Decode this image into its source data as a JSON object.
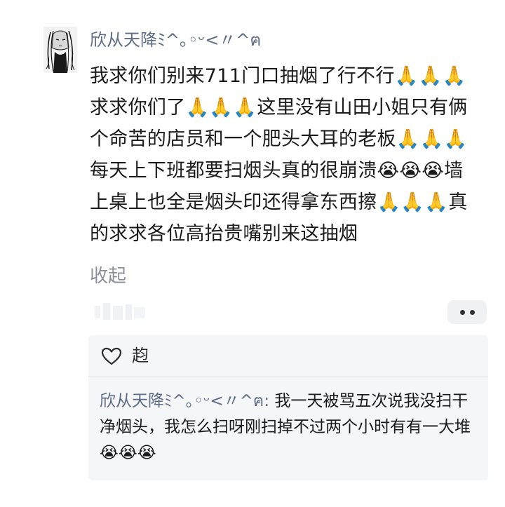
{
  "post": {
    "username": "欣从天降ﾐ^｡◦ᵕ<〃^ฅ",
    "segments": [
      {
        "t": "text",
        "v": "我求你们别来711门口抽烟了行不行"
      },
      {
        "t": "emoji",
        "name": "pray-icon",
        "glyph": "🙏"
      },
      {
        "t": "emoji",
        "name": "pray-icon",
        "glyph": "🙏"
      },
      {
        "t": "emoji",
        "name": "pray-icon",
        "glyph": "🙏"
      },
      {
        "t": "text",
        "v": "求求你们了"
      },
      {
        "t": "emoji",
        "name": "pray-icon",
        "glyph": "🙏"
      },
      {
        "t": "emoji",
        "name": "pray-icon",
        "glyph": "🙏"
      },
      {
        "t": "emoji",
        "name": "pray-icon",
        "glyph": "🙏"
      },
      {
        "t": "text",
        "v": "这里没有山田小姐只有俩个命苦的店员和一个肥头大耳的老板"
      },
      {
        "t": "emoji",
        "name": "pray-icon",
        "glyph": "🙏"
      },
      {
        "t": "emoji",
        "name": "pray-icon",
        "glyph": "🙏"
      },
      {
        "t": "emoji",
        "name": "pray-icon",
        "glyph": "🙏"
      },
      {
        "t": "text",
        "v": "每天上下班都要扫烟头真的很崩溃"
      },
      {
        "t": "emoji",
        "name": "loudly-crying-face-icon",
        "glyph": "😭"
      },
      {
        "t": "emoji",
        "name": "loudly-crying-face-icon",
        "glyph": "😭"
      },
      {
        "t": "emoji",
        "name": "loudly-crying-face-icon",
        "glyph": "😭"
      },
      {
        "t": "text",
        "v": "墙上桌上也全是烟头印还得拿东西擦"
      },
      {
        "t": "emoji",
        "name": "pray-icon",
        "glyph": "🙏"
      },
      {
        "t": "emoji",
        "name": "pray-icon",
        "glyph": "🙏"
      },
      {
        "t": "emoji",
        "name": "pray-icon",
        "glyph": "🙏"
      },
      {
        "t": "text",
        "v": "真的求求各位高抬贵嘴别来这抽烟"
      }
    ],
    "collapse_label": "收起",
    "more_label": "••"
  },
  "comment_panel": {
    "like_label": "赹",
    "reply_author": "欣从天降ﾐ^｡◦ᵕ<〃^ฅ:",
    "reply_segments": [
      {
        "t": "text",
        "v": " 我一天被骂五次说我没扫干净烟头，我怎么扫呀刚扫掉不过两个小时有有一大堆"
      },
      {
        "t": "emoji",
        "name": "loudly-crying-face-icon",
        "glyph": "😭"
      },
      {
        "t": "emoji",
        "name": "loudly-crying-face-icon",
        "glyph": "😭"
      },
      {
        "t": "emoji",
        "name": "loudly-crying-face-icon",
        "glyph": "😭"
      }
    ]
  },
  "colors": {
    "username": "#5e6c85",
    "panel_bg": "#f5f6f8",
    "muted": "#8a8f99"
  }
}
